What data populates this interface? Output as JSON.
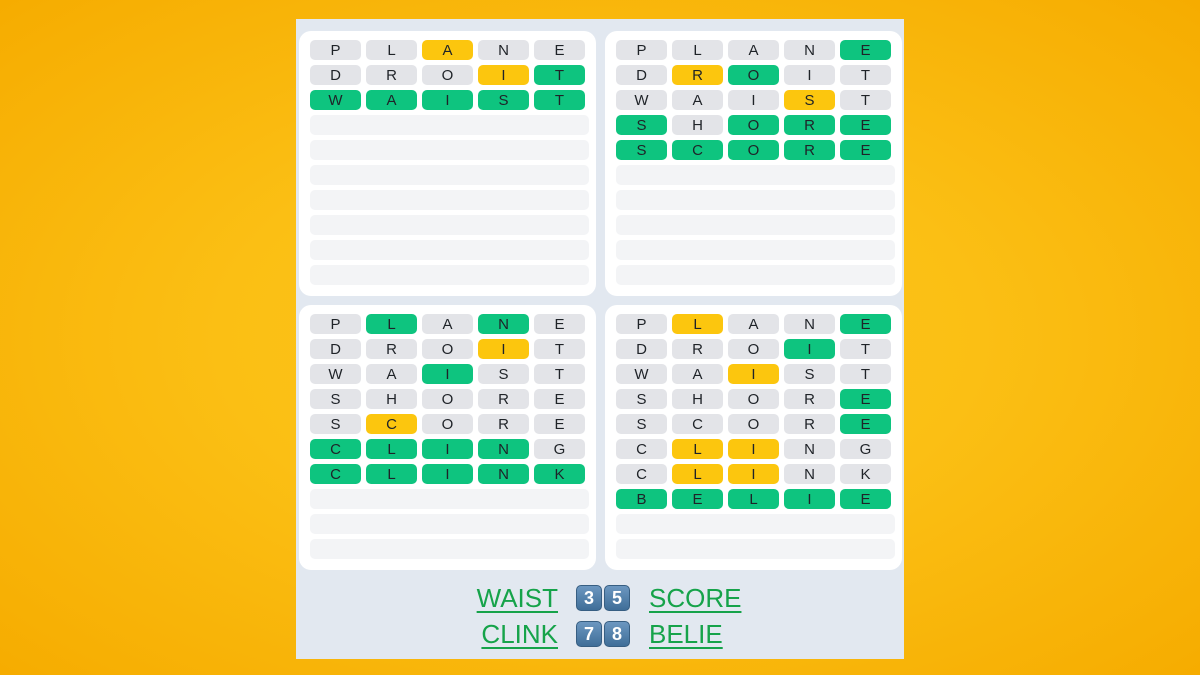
{
  "colors": {
    "correct": "#0ec47f",
    "present": "#fcc60e",
    "absent": "#e3e4e8",
    "answer_link": "#16a34a",
    "background": "#fbbf14"
  },
  "boards": [
    {
      "name": "board-top-left",
      "total_rows": 10,
      "guesses": [
        {
          "letters": [
            "P",
            "L",
            "A",
            "N",
            "E"
          ],
          "states": [
            "absent",
            "absent",
            "present",
            "absent",
            "absent"
          ]
        },
        {
          "letters": [
            "D",
            "R",
            "O",
            "I",
            "T"
          ],
          "states": [
            "absent",
            "absent",
            "absent",
            "present",
            "correct"
          ]
        },
        {
          "letters": [
            "W",
            "A",
            "I",
            "S",
            "T"
          ],
          "states": [
            "correct",
            "correct",
            "correct",
            "correct",
            "correct"
          ]
        }
      ]
    },
    {
      "name": "board-top-right",
      "total_rows": 10,
      "guesses": [
        {
          "letters": [
            "P",
            "L",
            "A",
            "N",
            "E"
          ],
          "states": [
            "absent",
            "absent",
            "absent",
            "absent",
            "correct"
          ]
        },
        {
          "letters": [
            "D",
            "R",
            "O",
            "I",
            "T"
          ],
          "states": [
            "absent",
            "present",
            "correct",
            "absent",
            "absent"
          ]
        },
        {
          "letters": [
            "W",
            "A",
            "I",
            "S",
            "T"
          ],
          "states": [
            "absent",
            "absent",
            "absent",
            "present",
            "absent"
          ]
        },
        {
          "letters": [
            "S",
            "H",
            "O",
            "R",
            "E"
          ],
          "states": [
            "correct",
            "absent",
            "correct",
            "correct",
            "correct"
          ]
        },
        {
          "letters": [
            "S",
            "C",
            "O",
            "R",
            "E"
          ],
          "states": [
            "correct",
            "correct",
            "correct",
            "correct",
            "correct"
          ]
        }
      ]
    },
    {
      "name": "board-bottom-left",
      "total_rows": 10,
      "guesses": [
        {
          "letters": [
            "P",
            "L",
            "A",
            "N",
            "E"
          ],
          "states": [
            "absent",
            "correct",
            "absent",
            "correct",
            "absent"
          ]
        },
        {
          "letters": [
            "D",
            "R",
            "O",
            "I",
            "T"
          ],
          "states": [
            "absent",
            "absent",
            "absent",
            "present",
            "absent"
          ]
        },
        {
          "letters": [
            "W",
            "A",
            "I",
            "S",
            "T"
          ],
          "states": [
            "absent",
            "absent",
            "correct",
            "absent",
            "absent"
          ]
        },
        {
          "letters": [
            "S",
            "H",
            "O",
            "R",
            "E"
          ],
          "states": [
            "absent",
            "absent",
            "absent",
            "absent",
            "absent"
          ]
        },
        {
          "letters": [
            "S",
            "C",
            "O",
            "R",
            "E"
          ],
          "states": [
            "absent",
            "present",
            "absent",
            "absent",
            "absent"
          ]
        },
        {
          "letters": [
            "C",
            "L",
            "I",
            "N",
            "G"
          ],
          "states": [
            "correct",
            "correct",
            "correct",
            "correct",
            "absent"
          ]
        },
        {
          "letters": [
            "C",
            "L",
            "I",
            "N",
            "K"
          ],
          "states": [
            "correct",
            "correct",
            "correct",
            "correct",
            "correct"
          ]
        }
      ]
    },
    {
      "name": "board-bottom-right",
      "total_rows": 10,
      "guesses": [
        {
          "letters": [
            "P",
            "L",
            "A",
            "N",
            "E"
          ],
          "states": [
            "absent",
            "present",
            "absent",
            "absent",
            "correct"
          ]
        },
        {
          "letters": [
            "D",
            "R",
            "O",
            "I",
            "T"
          ],
          "states": [
            "absent",
            "absent",
            "absent",
            "correct",
            "absent"
          ]
        },
        {
          "letters": [
            "W",
            "A",
            "I",
            "S",
            "T"
          ],
          "states": [
            "absent",
            "absent",
            "present",
            "absent",
            "absent"
          ]
        },
        {
          "letters": [
            "S",
            "H",
            "O",
            "R",
            "E"
          ],
          "states": [
            "absent",
            "absent",
            "absent",
            "absent",
            "correct"
          ]
        },
        {
          "letters": [
            "S",
            "C",
            "O",
            "R",
            "E"
          ],
          "states": [
            "absent",
            "absent",
            "absent",
            "absent",
            "correct"
          ]
        },
        {
          "letters": [
            "C",
            "L",
            "I",
            "N",
            "G"
          ],
          "states": [
            "absent",
            "present",
            "present",
            "absent",
            "absent"
          ]
        },
        {
          "letters": [
            "C",
            "L",
            "I",
            "N",
            "K"
          ],
          "states": [
            "absent",
            "present",
            "present",
            "absent",
            "absent"
          ]
        },
        {
          "letters": [
            "B",
            "E",
            "L",
            "I",
            "E"
          ],
          "states": [
            "correct",
            "correct",
            "correct",
            "correct",
            "correct"
          ]
        }
      ]
    }
  ],
  "answers": {
    "row1": {
      "left_word": "WAIST",
      "badges": [
        "3",
        "5"
      ],
      "right_word": "SCORE"
    },
    "row2": {
      "left_word": "CLINK",
      "badges": [
        "7",
        "8"
      ],
      "right_word": "BELIE"
    }
  }
}
